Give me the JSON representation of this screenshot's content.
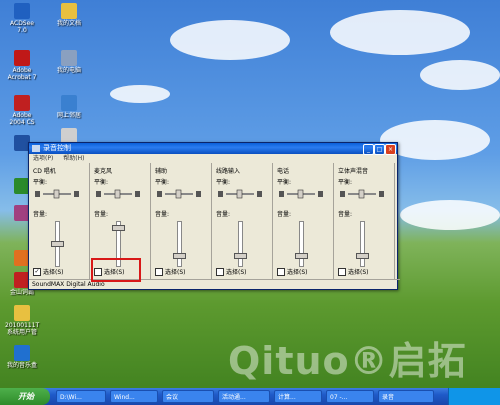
{
  "desktop_icons": [
    {
      "label": "ACDSee 7.0",
      "color": "#2060c0"
    },
    {
      "label": "我的文档",
      "color": "#e8c040"
    },
    {
      "label": "Adobe Acrobat 7",
      "color": "#c01818"
    },
    {
      "label": "我的电脑",
      "color": "#8aa0c0"
    },
    {
      "label": "Adobe 2004 CS",
      "color": "#c02020"
    },
    {
      "label": "网上邻居",
      "color": "#3a80d0"
    },
    {
      "label": "",
      "color": "#2050a0"
    },
    {
      "label": "",
      "color": "#cfcfcf"
    },
    {
      "label": "",
      "color": "#2b8a2b"
    },
    {
      "label": "",
      "color": "#a04080"
    },
    {
      "label": "",
      "color": "#e07020"
    },
    {
      "label": "金山词霸",
      "color": "#c02020"
    },
    {
      "label": "20100111T系统用户管",
      "color": "#e8c040"
    },
    {
      "label": "我的音乐盒",
      "color": "#2070d0"
    }
  ],
  "window": {
    "title": "录音控制",
    "menu": [
      "选项(P)",
      "帮助(H)"
    ],
    "buttons": [
      "_",
      "□",
      "×"
    ],
    "channels": [
      {
        "name": "CD 唱机",
        "balance": "平衡:",
        "volume": "音量:",
        "select": "选择(S)",
        "checked": true,
        "level": 0.5
      },
      {
        "name": "麦克风",
        "balance": "平衡:",
        "volume": "音量:",
        "select": "选择(S)",
        "checked": false,
        "level": 0.9
      },
      {
        "name": "辅助",
        "balance": "平衡:",
        "volume": "音量:",
        "select": "选择(S)",
        "checked": false,
        "level": 0.2
      },
      {
        "name": "线路输入",
        "balance": "平衡:",
        "volume": "音量:",
        "select": "选择(S)",
        "checked": false,
        "level": 0.2
      },
      {
        "name": "电话",
        "balance": "平衡:",
        "volume": "音量:",
        "select": "选择(S)",
        "checked": false,
        "level": 0.2
      },
      {
        "name": "立体声混音",
        "balance": "平衡:",
        "volume": "音量:",
        "select": "选择(S)",
        "checked": false,
        "level": 0.2
      }
    ],
    "status": "SoundMAX Digital Audio"
  },
  "taskbar": {
    "start": "开始",
    "items": [
      "D:\\Wi...",
      "Wind...",
      "会议",
      "活动通...",
      "计算...",
      "07 -...",
      "录音"
    ],
    "clock": ""
  },
  "watermark": "Qituo®启拓"
}
